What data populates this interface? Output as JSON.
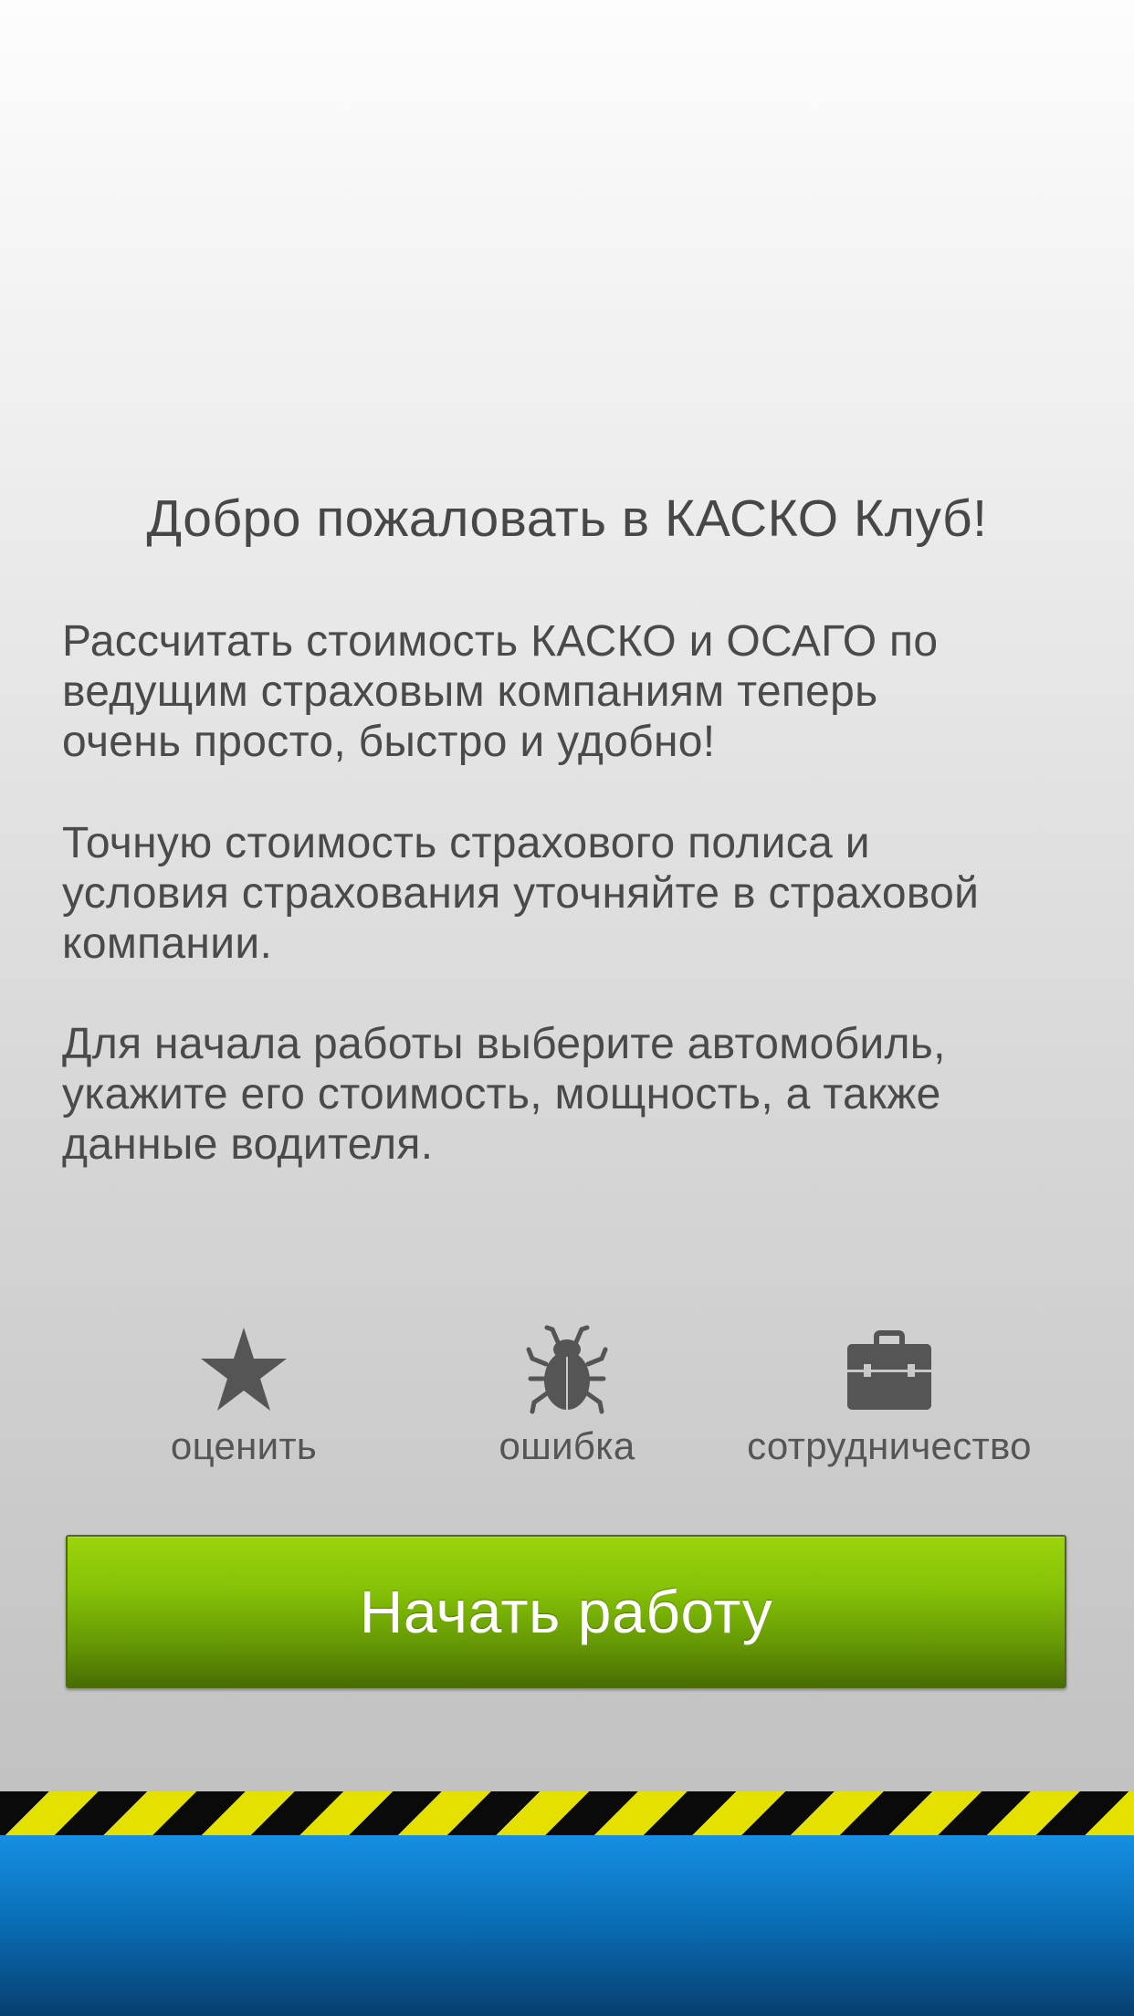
{
  "welcome": {
    "title": "Добро пожаловать в КАСКО Клуб!",
    "paragraphs": [
      [
        "Рассчитать стоимость КАСКО и ОСАГО по",
        "ведущим страховым компаниям теперь",
        "очень просто, быстро и удобно!"
      ],
      [
        "Точную стоимость страхового полиса и",
        "условия страхования уточняйте в страховой",
        "компании."
      ],
      [
        "Для начала работы выберите автомобиль,",
        "укажите его стоимость, мощность, а также",
        "данные водителя."
      ]
    ]
  },
  "actions": [
    {
      "label": "оценить",
      "icon": "star-icon"
    },
    {
      "label": "ошибка",
      "icon": "bug-icon"
    },
    {
      "label": "сотрудничество",
      "icon": "briefcase-icon"
    }
  ],
  "start_button": {
    "label": "Начать работу"
  },
  "colors": {
    "button_green": "#86c207",
    "icon_gray": "#555555",
    "hazard_yellow": "#e4e000",
    "hazard_black": "#0a0a0a",
    "bottom_blue": "#0b70b9"
  }
}
